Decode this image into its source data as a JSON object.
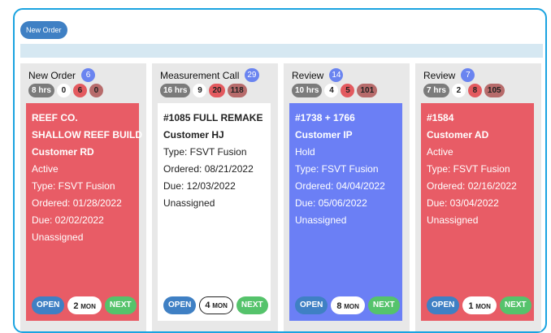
{
  "toolbar": {
    "new_order_label": "New Order"
  },
  "columns": [
    {
      "title": "New Order",
      "count": "6",
      "stats": {
        "hrs": "8 hrs",
        "white": "0",
        "red": "6",
        "dark": "0"
      },
      "card": {
        "color": "red",
        "lines": [
          "REEF CO.",
          "SHALLOW REEF BUILD",
          "Customer RD",
          "Active",
          "Type: FSVT Fusion",
          "Ordered: 01/28/2022",
          "Due: 02/02/2022",
          "Unassigned"
        ],
        "mon_num": "2",
        "mon_unit": "MON"
      }
    },
    {
      "title": "Measurement Call",
      "count": "29",
      "stats": {
        "hrs": "16 hrs",
        "white": "9",
        "red": "20",
        "dark": "118"
      },
      "card": {
        "color": "white",
        "lines": [
          "#1085 FULL REMAKE",
          "Customer HJ",
          "Type: FSVT Fusion",
          "Ordered: 08/21/2022",
          "Due: 12/03/2022",
          "Unassigned"
        ],
        "mon_num": "4",
        "mon_unit": "MON"
      }
    },
    {
      "title": "Review",
      "count": "14",
      "stats": {
        "hrs": "10 hrs",
        "white": "4",
        "red": "5",
        "dark": "101"
      },
      "card": {
        "color": "blue",
        "lines": [
          "#1738 + 1766",
          "Customer IP",
          "Hold",
          "Type: FSVT Fusion",
          "Ordered: 04/04/2022",
          "Due: 05/06/2022",
          "Unassigned"
        ],
        "mon_num": "8",
        "mon_unit": "MON"
      }
    },
    {
      "title": "Review",
      "count": "7",
      "stats": {
        "hrs": "7 hrs",
        "white": "2",
        "red": "8",
        "dark": "105"
      },
      "card": {
        "color": "red",
        "lines": [
          "#1584",
          "Customer AD",
          "Active",
          "Type: FSVT Fusion",
          "Ordered: 02/16/2022",
          "Due: 03/04/2022",
          "Unassigned"
        ],
        "mon_num": "1",
        "mon_unit": "MON"
      }
    }
  ],
  "actions": {
    "open_label": "OPEN",
    "next_label": "NEXT"
  },
  "colors": {
    "frame": "#1aa3e0",
    "red_card": "#e85c66",
    "blue_card": "#6b7ff5",
    "open": "#3f80c4",
    "next": "#55c36b"
  }
}
